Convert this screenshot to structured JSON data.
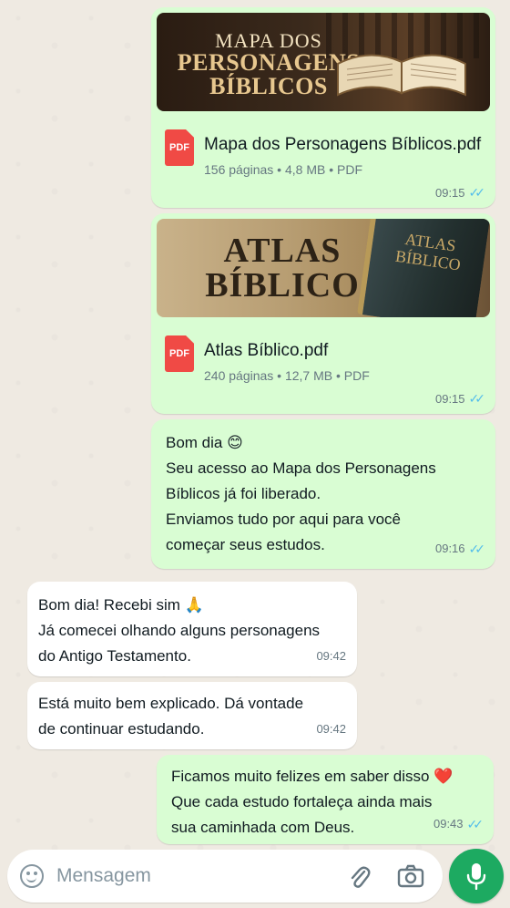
{
  "chat": {
    "documents": [
      {
        "cover_lines": [
          "MAPA DOS",
          "PERSONAGENS",
          "BÍBLICOS"
        ],
        "name": "Mapa dos Personagens Bíblicos.pdf",
        "meta": "156 páginas • 4,8 MB • PDF",
        "icon_label": "PDF",
        "time": "09:15"
      },
      {
        "cover_lines": [
          "ATLAS",
          "BÍBLICO"
        ],
        "book_lines": [
          "ATLAS",
          "BÍBLICO"
        ],
        "name": "Atlas Bíblico.pdf",
        "meta": "240 páginas • 12,7 MB • PDF",
        "icon_label": "PDF",
        "time": "09:15"
      }
    ],
    "messages": [
      {
        "direction": "out",
        "lines": [
          "Bom dia",
          "Seu acesso ao Mapa dos Personagens",
          "Bíblicos já foi liberado.",
          "Enviamos tudo por aqui para você",
          "começar seus estudos."
        ],
        "emoji": "😊",
        "time": "09:16"
      },
      {
        "direction": "in",
        "lines": [
          "Bom dia! Recebi sim",
          "Já comecei olhando alguns personagens",
          "do Antigo Testamento."
        ],
        "emoji": "🙏",
        "time": "09:42"
      },
      {
        "direction": "in",
        "lines": [
          "Está muito bem explicado. Dá vontade",
          "de continuar estudando."
        ],
        "time": "09:42"
      },
      {
        "direction": "out",
        "lines": [
          "Ficamos muito felizes em saber disso",
          "Que cada estudo fortaleça ainda mais",
          "sua caminhada com Deus."
        ],
        "emoji": "❤️",
        "time": "09:43"
      }
    ],
    "read_ticks": "✓✓"
  },
  "composer": {
    "placeholder": "Mensagem",
    "icons": [
      "smile-icon",
      "paperclip-icon",
      "camera-icon",
      "microphone-icon"
    ]
  },
  "colors": {
    "background": "#efeae2",
    "outgoing_bubble": "#d9fdd3",
    "incoming_bubble": "#ffffff",
    "read_ticks": "#53bdeb",
    "mic_button": "#1daa61",
    "pdf_icon": "#f04a45"
  }
}
